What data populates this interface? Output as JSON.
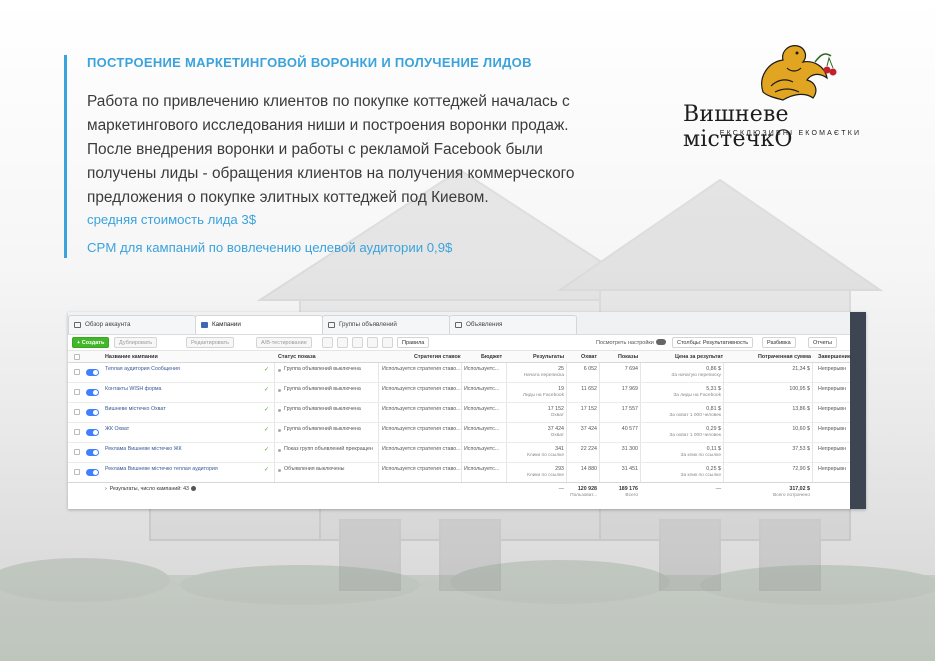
{
  "heading": "ПОСТРОЕНИЕ МАРКЕТИНГОВОЙ ВОРОНКИ И ПОЛУЧЕНИЕ ЛИДОВ",
  "body_lines": [
    "Работа по привлечению клиентов по покупке коттеджей началась с",
    "маркетингового исследования ниши и построения воронки продаж.",
    "После внедрения воронки и работы с рекламой Facebook были",
    "получены лиды - обращения клиентов на получения коммерческого",
    "предложения о покупке элитных коттеджей под Киевом."
  ],
  "highlights": [
    "средняя стоимость лида 3$",
    "CPM для кампаний по вовлечению целевой аудитории 0,9$"
  ],
  "logo": {
    "title": "Вишневе містечкО",
    "subtitle": "ЕКСКЛЮЗИВНІ ЕКОМАЄТКИ",
    "icon": "golden-bird-with-cherries-icon"
  },
  "colors": {
    "accent": "#3aa3dc",
    "create_button": "#42b72a",
    "toggle": "#4080ff",
    "link": "#385898"
  },
  "ads_manager": {
    "tabs": [
      "Обзор аккаунта",
      "Кампании",
      "Группы объявлений",
      "Объявления"
    ],
    "toolbar": {
      "create": "+ Создать",
      "duplicate": "Дублировать",
      "edit": "Редактировать",
      "ab_test": "A/B-тестирование",
      "rules": "Правила",
      "view_settings": "Посмотреть настройки",
      "columns": "Столбцы: Результативность",
      "breakdown": "Разбивка",
      "reports": "Отчеты"
    },
    "columns": [
      "Название кампании",
      "Статус показа",
      "Стратегия ставок",
      "Бюджет",
      "Результаты",
      "Охват",
      "Показы",
      "Цена за результат",
      "Потраченная сумма",
      "Завершение"
    ],
    "rows": [
      {
        "name": "Теплая аудитория Сообщения",
        "status": "Группа объявлений выключена",
        "strategy": "Используется стратегия ставо...",
        "budget": "Используетс...",
        "results": "25",
        "results_sub": "Начата переписка",
        "reach": "6 052",
        "impressions": "7 694",
        "cpr": "0,86 $",
        "cpr_sub": "За начатую переписку",
        "spent": "21,34 $",
        "end": "Непрерывн"
      },
      {
        "name": "Контакты WISH форма",
        "status": "Группа объявлений выключена",
        "strategy": "Используется стратегия ставо...",
        "budget": "Используетс...",
        "results": "19",
        "results_sub": "Лиды на Facebook",
        "reach": "11 652",
        "impressions": "17 969",
        "cpr": "5,31 $",
        "cpr_sub": "За лиды на Facebook",
        "spent": "100,95 $",
        "end": "Непрерывн"
      },
      {
        "name": "Вишневе містечко Охват",
        "status": "Группа объявлений выключена",
        "strategy": "Используется стратегия ставо...",
        "budget": "Используетс...",
        "results": "17 152",
        "results_sub": "Охват",
        "reach": "17 152",
        "impressions": "17 557",
        "cpr": "0,81 $",
        "cpr_sub": "За охват 1 000 человек",
        "spent": "13,86 $",
        "end": "Непрерывн"
      },
      {
        "name": "ЖК Охват",
        "status": "Группа объявлений выключена",
        "strategy": "Используется стратегия ставо...",
        "budget": "Используетс...",
        "results": "37 424",
        "results_sub": "Охват",
        "reach": "37 424",
        "impressions": "40 577",
        "cpr": "0,29 $",
        "cpr_sub": "За охват 1 000 человек",
        "spent": "10,60 $",
        "end": "Непрерывн"
      },
      {
        "name": "Реклама Вишневе містечко ЖК",
        "status": "Показ групп объявлений прекращен",
        "strategy": "Используется стратегия ставо...",
        "budget": "Используетс...",
        "results": "341",
        "results_sub": "Клики по ссылке",
        "reach": "22 224",
        "impressions": "31 300",
        "cpr": "0,11 $",
        "cpr_sub": "За клик по ссылке",
        "spent": "37,53 $",
        "end": "Непрерывн"
      },
      {
        "name": "Реклама Вишневе містечко теплая аудитория",
        "status": "Объявления выключены",
        "strategy": "Используется стратегия ставо...",
        "budget": "Используетс...",
        "results": "293",
        "results_sub": "Клики по ссылке",
        "reach": "14 880",
        "impressions": "31 451",
        "cpr": "0,25 $",
        "cpr_sub": "За клик по ссылке",
        "spent": "72,90 $",
        "end": "Непрерывн"
      }
    ],
    "totals": {
      "label": "Результаты, число кампаний: 43",
      "results": "—",
      "reach": "120 928",
      "reach_sub": "Пользоват...",
      "impressions": "189 176",
      "impressions_sub": "Всего",
      "cpr": "—",
      "spent": "317,02 $",
      "spent_sub": "Всего потрачено"
    }
  }
}
